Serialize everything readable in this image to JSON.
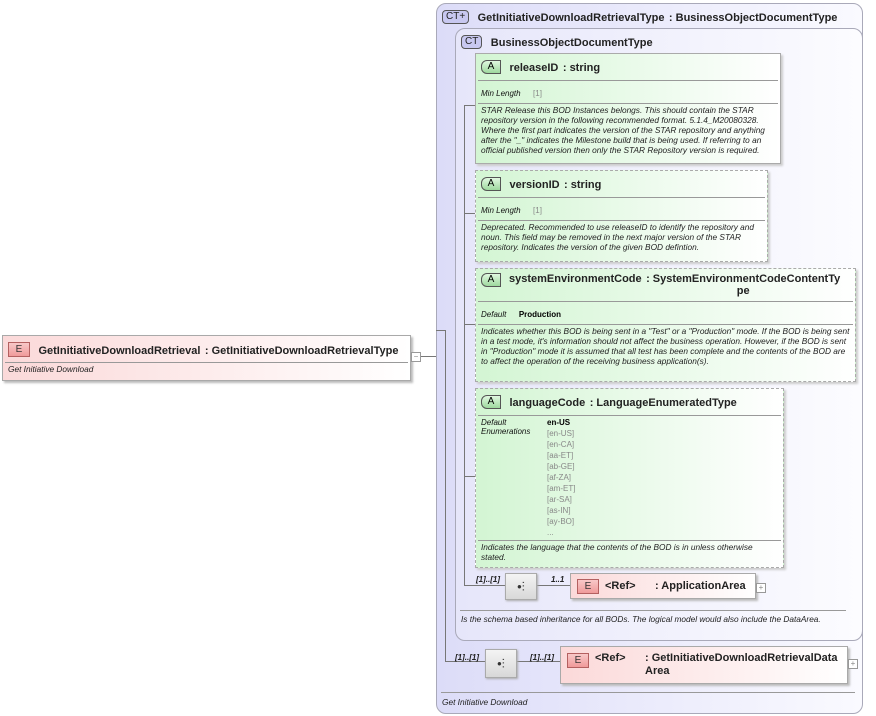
{
  "root": {
    "badge": "E",
    "name": "GetInitiativeDownloadRetrieval",
    "type": ": GetInitiativeDownloadRetrievalType",
    "desc": "Get Initiative Download",
    "collapse": "−"
  },
  "outer": {
    "badge": "CT+",
    "name": "GetInitiativeDownloadRetrievalType",
    "type": ": BusinessObjectDocumentType",
    "desc": "Get Initiative Download"
  },
  "inner": {
    "badge": "CT",
    "name": "BusinessObjectDocumentType",
    "desc": "Is the schema based inheritance for all BODs. The logical model would also include the DataArea."
  },
  "attributes": [
    {
      "badge": "A",
      "name": "releaseID",
      "type": ": string",
      "facet_label": "Min Length",
      "facet_value": "[1]",
      "desc": "STAR Release this BOD Instances belongs. This should contain the STAR repository version in the following recommended format. 5.1.4_M20080328. Where the first part indicates the version of the STAR repository and anything after the \"_\" indicates the Milestone build that is being used. If referring to an official published version then only the STAR Repository version is required."
    },
    {
      "badge": "A",
      "name": "versionID",
      "type": ": string",
      "facet_label": "Min Length",
      "facet_value": "[1]",
      "desc": "Deprecated. Recommended to use releaseID to identify the repository and noun. This field may be removed in the next major version of the STAR repository. Indicates the version of the given BOD defintion."
    },
    {
      "badge": "A",
      "name": "systemEnvironmentCode",
      "type": ": SystemEnvironmentCodeContentType",
      "facet_label": "Default",
      "facet_value": "Production",
      "desc": "Indicates whether this BOD is being sent in a \"Test\" or a \"Production\" mode. If the BOD is being sent in a test mode, it's information should not affect the business operation. However, if the BOD is sent in \"Production\" mode it is assumed that all test has been complete and the contents of the BOD are to affect the operation of the receiving business application(s)."
    },
    {
      "badge": "A",
      "name": "languageCode",
      "type": ": LanguageEnumeratedType",
      "facet_label": "Default",
      "facet_value": "en-US",
      "enum_label": "Enumerations",
      "enumerations": [
        "[en-US]",
        "[en-CA]",
        "[aa-ET]",
        "[ab-GE]",
        "[af-ZA]",
        "[am-ET]",
        "[ar-SA]",
        "[as-IN]",
        "[ay-BO]",
        "..."
      ],
      "desc": "Indicates the language that the contents of the BOD is in unless otherwise stated."
    }
  ],
  "inner_seq": {
    "occurs": "[1]..[1]",
    "child_occurs": "1..1",
    "ref_badge": "E",
    "ref": "<Ref>",
    "ref_type": ": ApplicationArea",
    "expand": "+"
  },
  "outer_seq": {
    "occurs": "[1]..[1]",
    "child_occurs": "[1]..[1]",
    "ref_badge": "E",
    "ref": "<Ref>",
    "ref_type": ": GetInitiativeDownloadRetrievalDataArea",
    "expand": "+"
  },
  "colors": {
    "element": "#fbd9d9",
    "attribute": "#d3f5d3",
    "complex_type": "#dcdcf8"
  }
}
